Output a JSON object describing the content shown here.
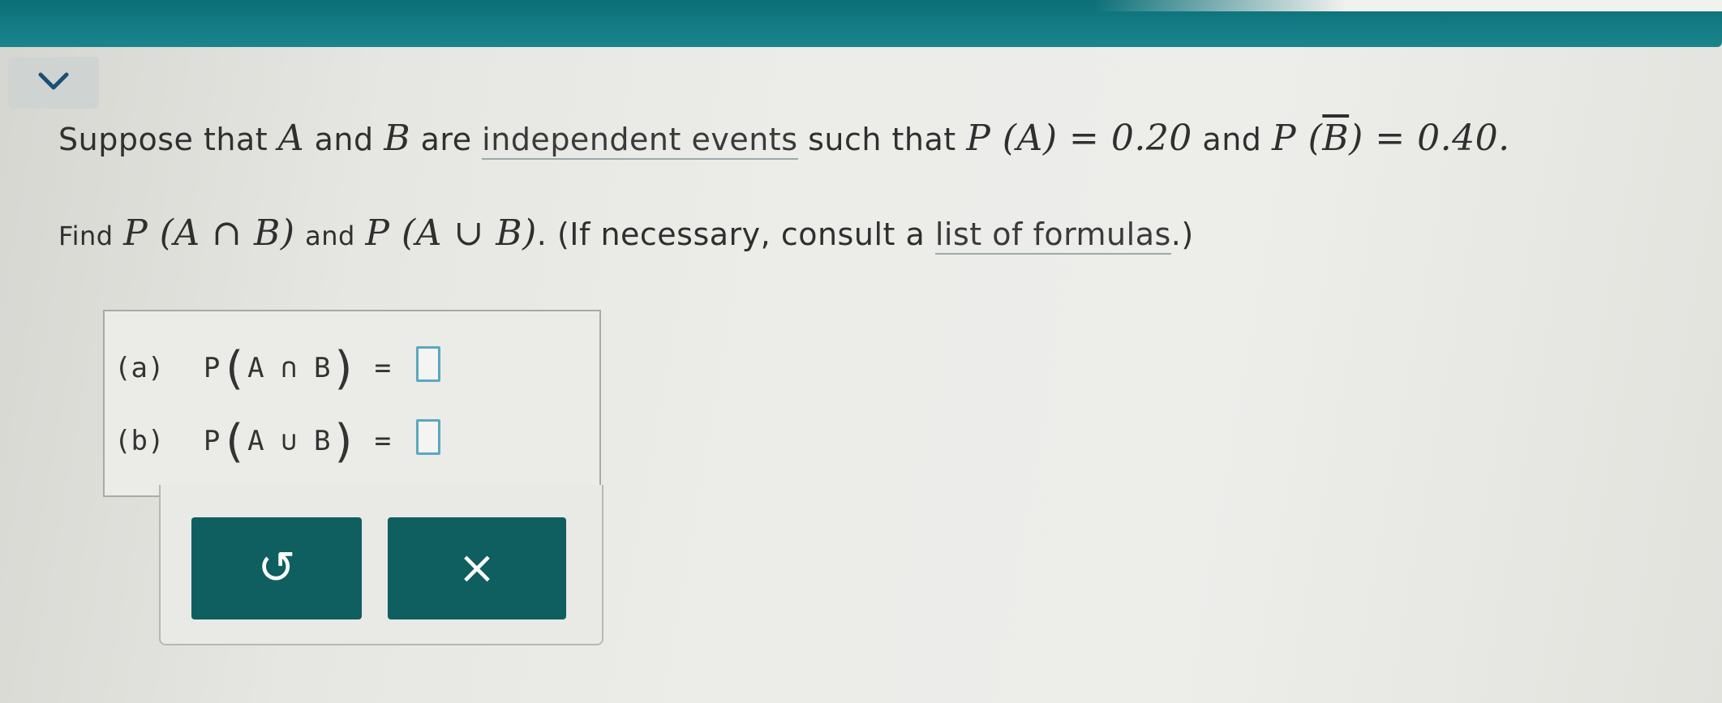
{
  "header": {
    "collapse_icon": "chevron-down-icon",
    "accent_color": "#157e86"
  },
  "question": {
    "line1": {
      "suppose": "Suppose that",
      "a": "A",
      "and1": "and",
      "b": "B",
      "are": "are",
      "link": "independent events",
      "such_that": "such that",
      "pa_expr": "P (A) = 0.20",
      "and2": "and",
      "pb_prefix": "P (",
      "pb_bar": "B",
      "pb_suffix": ") = 0.40."
    },
    "line2": {
      "find": "Find",
      "intersect_expr": "P (A ∩ B)",
      "and": "and",
      "union_expr": "P (A ∪ B)",
      "consult": ". (If necessary, consult a",
      "link": "list of formulas",
      "end": ".)"
    }
  },
  "answers": {
    "a": {
      "label": "(a)",
      "p": "P",
      "inner": "A ∩ B",
      "equals": "="
    },
    "b": {
      "label": "(b)",
      "p": "P",
      "inner": "A ∪ B",
      "equals": "="
    }
  },
  "buttons": {
    "undo_glyph": "↺",
    "undo_icon": "undo-icon",
    "clear_glyph": "×",
    "clear_icon": "close-icon",
    "color": "#0f5e60"
  }
}
